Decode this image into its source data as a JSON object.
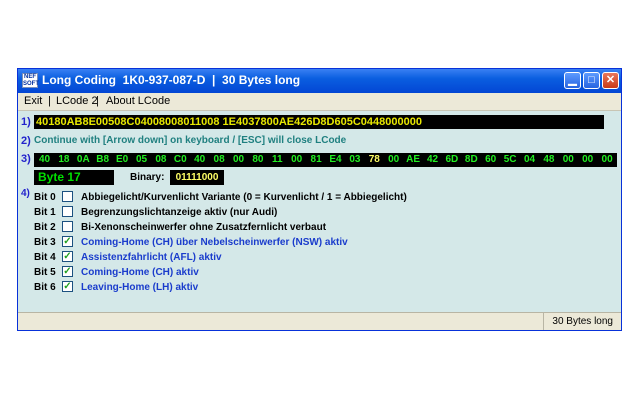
{
  "window": {
    "icon_text": "NEF SOFT",
    "title": "Long Coding  1K0-937-087-D  |  30 Bytes long"
  },
  "menu": {
    "exit": "Exit",
    "lcode2": "LCode 2",
    "about": "About LCode",
    "separator": "|"
  },
  "section_numbers": [
    "1)",
    "2)",
    "3)",
    "4)"
  ],
  "coding_string": "40180AB8E00508C04008008011008 1E4037800AE426D8D605C0448000000",
  "hint": "Continue with [Arrow down] on keyboard / [ESC] will close LCode",
  "bytes": [
    "40",
    "18",
    "0A",
    "B8",
    "E0",
    "05",
    "08",
    "C0",
    "40",
    "08",
    "00",
    "80",
    "11",
    "00",
    "81",
    "E4",
    "03",
    "78",
    "00",
    "AE",
    "42",
    "6D",
    "8D",
    "60",
    "5C",
    "04",
    "48",
    "00",
    "00",
    "00"
  ],
  "selected_byte_index": 17,
  "byte_label": "Byte 17",
  "binary_label": "Binary:",
  "binary_value": "01111000",
  "bits": [
    {
      "name": "Bit 0",
      "checked": false,
      "desc": "Abbiegelicht/Kurvenlicht Variante (0 = Kurvenlicht / 1 = Abbiegelicht)"
    },
    {
      "name": "Bit 1",
      "checked": false,
      "desc": "Begrenzungslichtanzeige aktiv (nur Audi)"
    },
    {
      "name": "Bit 2",
      "checked": false,
      "desc": "Bi-Xenonscheinwerfer ohne Zusatzfernlicht verbaut"
    },
    {
      "name": "Bit 3",
      "checked": true,
      "desc": "Coming-Home (CH) über Nebelscheinwerfer (NSW) aktiv"
    },
    {
      "name": "Bit 4",
      "checked": true,
      "desc": "Assistenzfahrlicht (AFL) aktiv"
    },
    {
      "name": "Bit 5",
      "checked": true,
      "desc": "Coming-Home (CH) aktiv"
    },
    {
      "name": "Bit 6",
      "checked": true,
      "desc": "Leaving-Home (LH) aktiv"
    }
  ],
  "status": {
    "right": "30 Bytes long"
  },
  "colors": {
    "window_bg": "#d4e8e8",
    "byte_text": "#22ee22",
    "selected_byte_text": "#ffff66",
    "active_bit_text": "#1a3ccc"
  }
}
